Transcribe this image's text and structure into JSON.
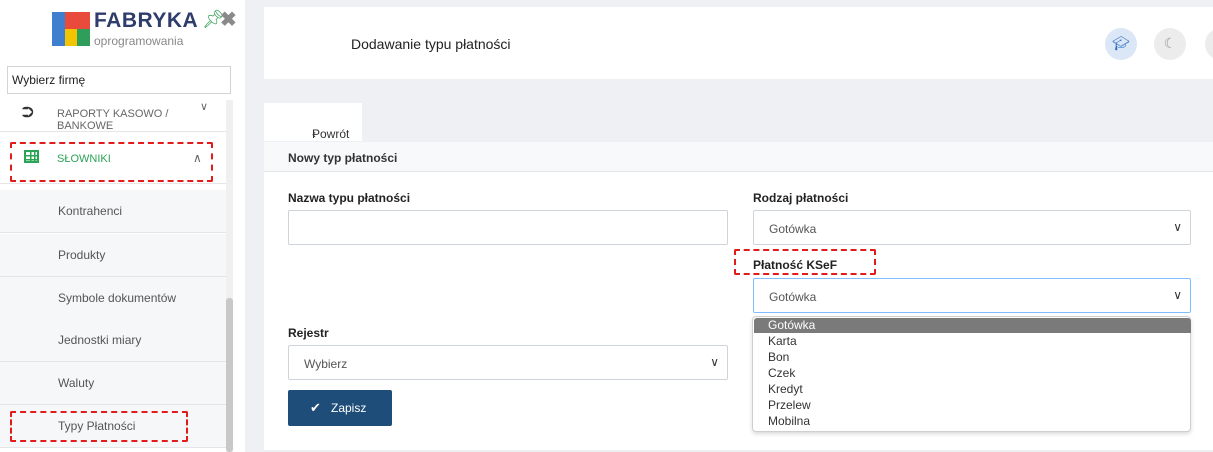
{
  "sidebar": {
    "logo": {
      "title": "FABRYKA",
      "subtitle": "oprogramowania"
    },
    "company_select": "Wybierz firmę",
    "menu": {
      "raporty": "RAPORTY KASOWO / BANKOWE",
      "slowniki": "SŁOWNIKI"
    },
    "sub_items": [
      "Kontrahenci",
      "Produkty",
      "Symbole dokumentów",
      "Jednostki miary",
      "Waluty",
      "Typy Płatności"
    ]
  },
  "header": {
    "title": "Dodawanie typu płatności"
  },
  "back_label": "Powrót",
  "form": {
    "card_title": "Nowy typ płatności",
    "name_label": "Nazwa typu płatności",
    "name_value": "",
    "payment_kind_label": "Rodzaj płatności",
    "payment_kind_value": "Gotówka",
    "ksef_label": "Płatność KSeF",
    "ksef_value": "Gotówka",
    "register_label": "Rejestr",
    "register_value": "Wybierz",
    "save_label": "Zapisz"
  },
  "dropdown": {
    "options": [
      "Gotówka",
      "Karta",
      "Bon",
      "Czek",
      "Kredyt",
      "Przelew",
      "Mobilna"
    ],
    "selected": "Gotówka"
  },
  "colors": {
    "accent_green": "#2aa455",
    "primary_button": "#1f4d7a",
    "annotation_red": "#e31b1b"
  }
}
